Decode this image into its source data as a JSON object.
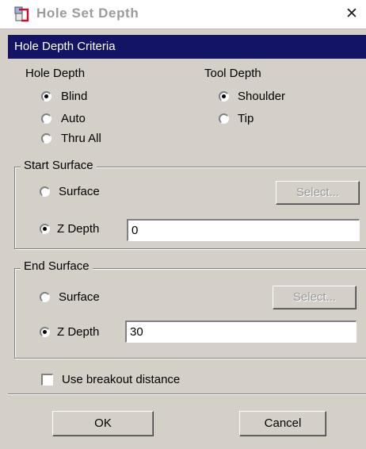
{
  "window": {
    "title": "Hole Set Depth",
    "close_glyph": "✕"
  },
  "header": {
    "title": "Hole Depth Criteria"
  },
  "hole_depth": {
    "label": "Hole Depth",
    "options": [
      {
        "label": "Blind",
        "checked": true
      },
      {
        "label": "Auto",
        "checked": false
      },
      {
        "label": "Thru All",
        "checked": false
      }
    ]
  },
  "tool_depth": {
    "label": "Tool Depth",
    "options": [
      {
        "label": "Shoulder",
        "checked": true
      },
      {
        "label": "Tip",
        "checked": false
      }
    ]
  },
  "start_surface": {
    "legend": "Start Surface",
    "surface_label": "Surface",
    "select_label": "Select...",
    "zdepth_label": "Z Depth",
    "zdepth_value": "0"
  },
  "end_surface": {
    "legend": "End Surface",
    "surface_label": "Surface",
    "select_label": "Select...",
    "zdepth_label": "Z Depth",
    "zdepth_value": "30"
  },
  "breakout": {
    "label": "Use breakout distance",
    "checked": false
  },
  "buttons": {
    "ok": "OK",
    "cancel": "Cancel"
  },
  "colors": {
    "header_bg": "#141464",
    "face": "#d4d0c8",
    "title_text": "#9b9b9b"
  },
  "icons": {
    "title": "hole-tool-icon"
  }
}
